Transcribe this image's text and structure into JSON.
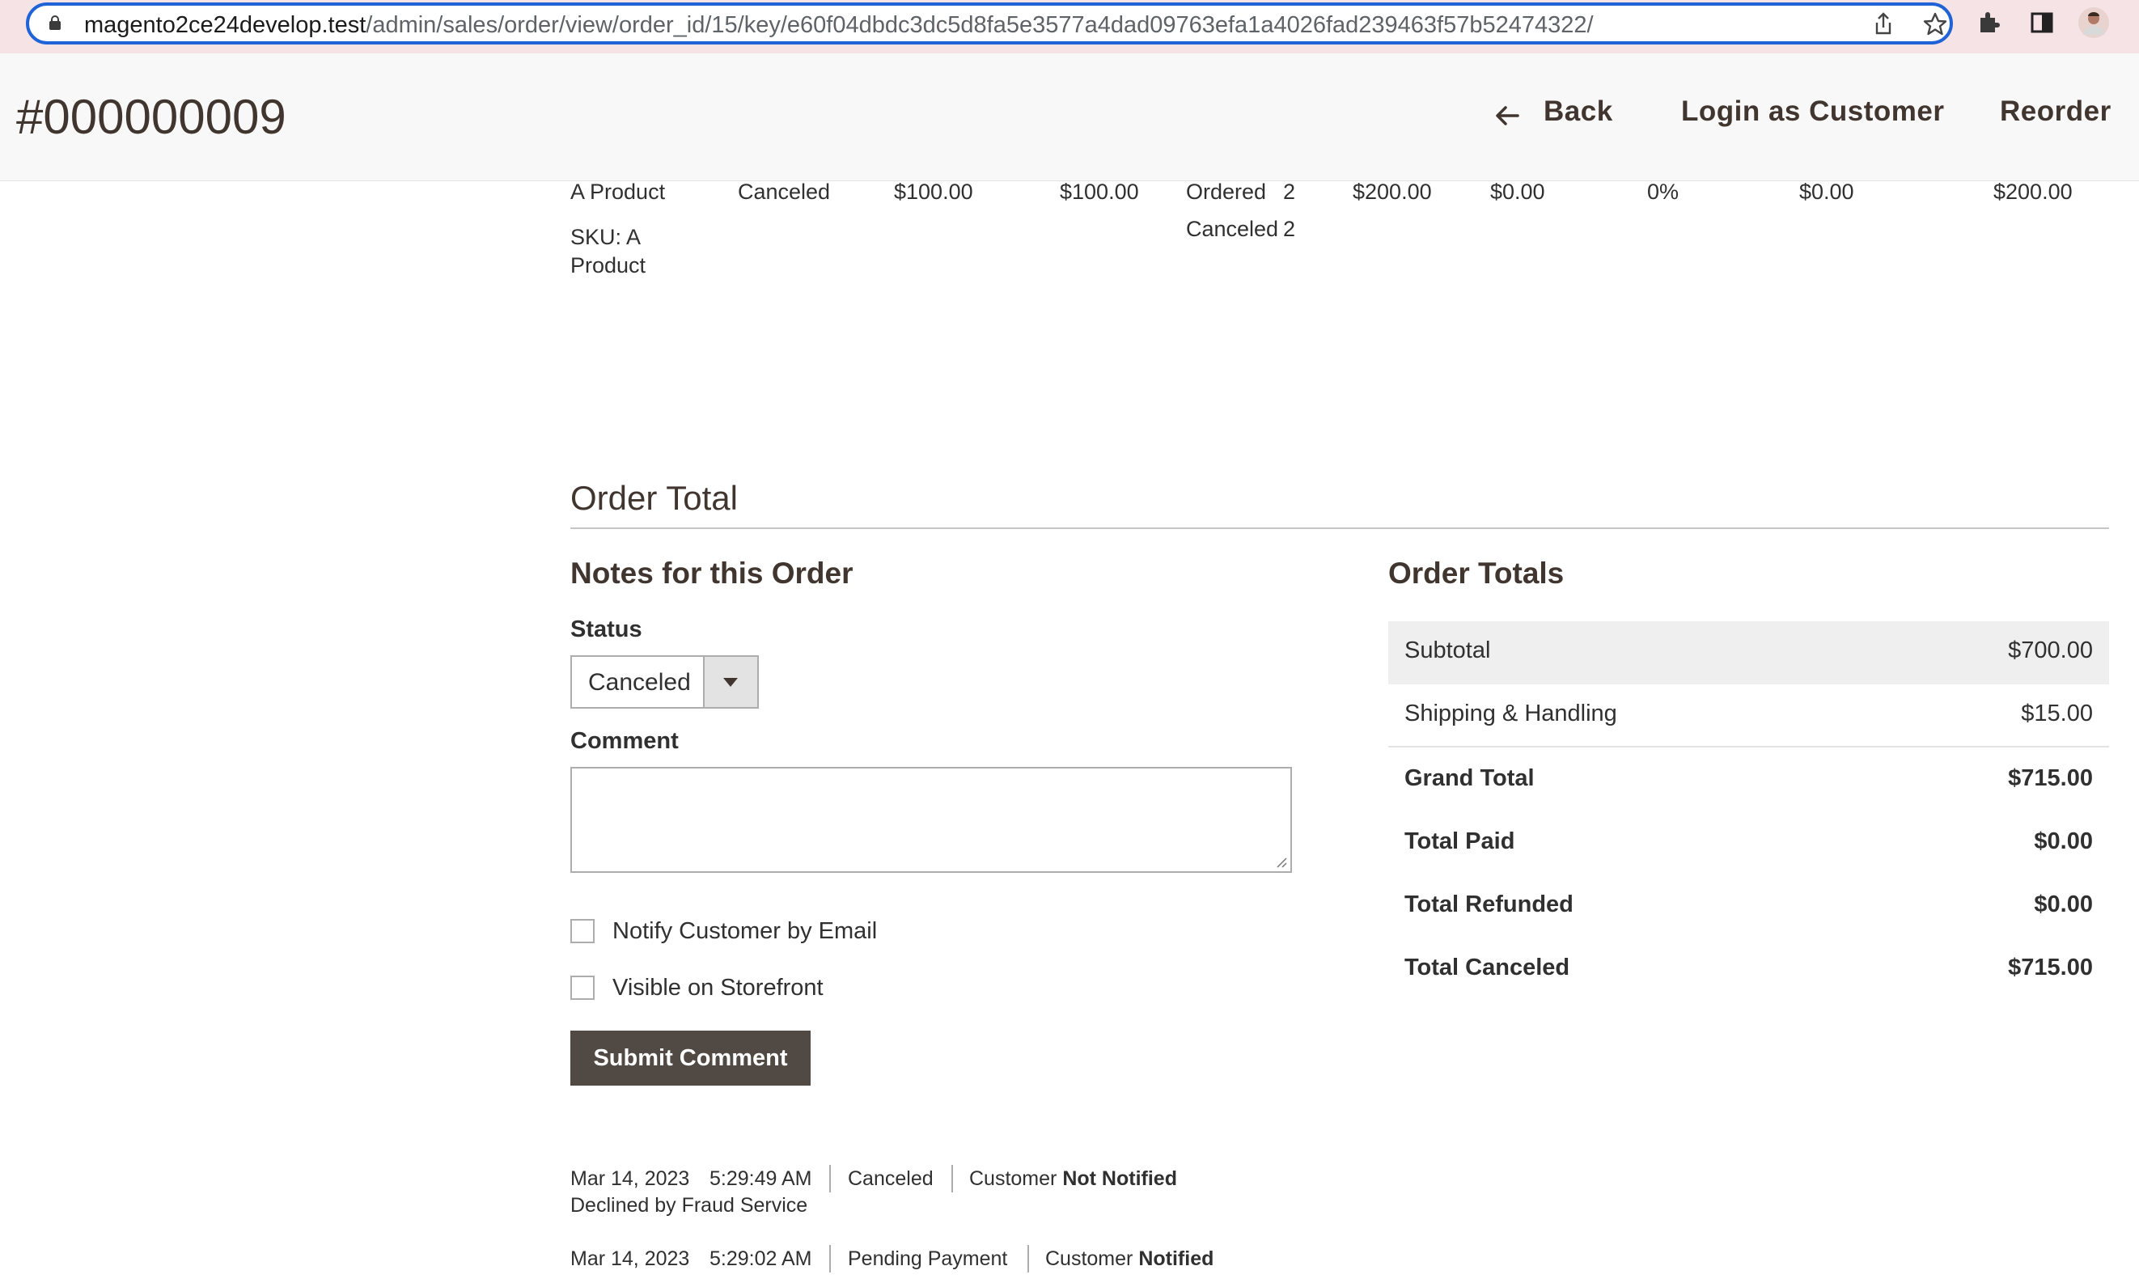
{
  "browser": {
    "url_host": "magento2ce24develop.test",
    "url_path": "/admin/sales/order/view/order_id/15/key/e60f04dbdc3dc5d8fa5e3577a4dad09763efa1a4026fad239463f57b52474322/"
  },
  "header": {
    "order_number": "#000000009",
    "back_label": "Back",
    "login_as_customer_label": "Login as Customer",
    "reorder_label": "Reorder"
  },
  "item": {
    "name": "A Product",
    "sku_line1": "SKU: A",
    "sku_line2": "Product",
    "status": "Canceled",
    "original_price": "$100.00",
    "price": "$100.00",
    "qty_ordered_label": "Ordered",
    "qty_ordered": "2",
    "qty_canceled_label": "Canceled",
    "qty_canceled": "2",
    "subtotal": "$200.00",
    "tax_amount": "$0.00",
    "tax_percent": "0%",
    "discount_amount": "$0.00",
    "row_total": "$200.00"
  },
  "order_total": {
    "section_title": "Order Total",
    "notes": {
      "title": "Notes for this Order",
      "status_label": "Status",
      "status_value": "Canceled",
      "comment_label": "Comment",
      "notify_label": "Notify Customer by Email",
      "visible_label": "Visible on Storefront",
      "submit_label": "Submit Comment"
    },
    "totals": {
      "title": "Order Totals",
      "rows": [
        {
          "label": "Subtotal",
          "value": "$700.00"
        },
        {
          "label": "Shipping & Handling",
          "value": "$15.00"
        },
        {
          "label": "Grand Total",
          "value": "$715.00"
        },
        {
          "label": "Total Paid",
          "value": "$0.00"
        },
        {
          "label": "Total Refunded",
          "value": "$0.00"
        },
        {
          "label": "Total Canceled",
          "value": "$715.00"
        }
      ]
    }
  },
  "history": [
    {
      "date": "Mar 14, 2023",
      "time": "5:29:49 AM",
      "status": "Canceled",
      "customer_prefix": "Customer",
      "notified": "Not Notified",
      "comment": "Declined by Fraud Service"
    },
    {
      "date": "Mar 14, 2023",
      "time": "5:29:02 AM",
      "status": "Pending Payment",
      "customer_prefix": "Customer",
      "notified": "Notified"
    }
  ],
  "colors": {
    "accent_blue": "#1f63d6",
    "button_dark": "#514943",
    "header_text": "#41362f"
  }
}
